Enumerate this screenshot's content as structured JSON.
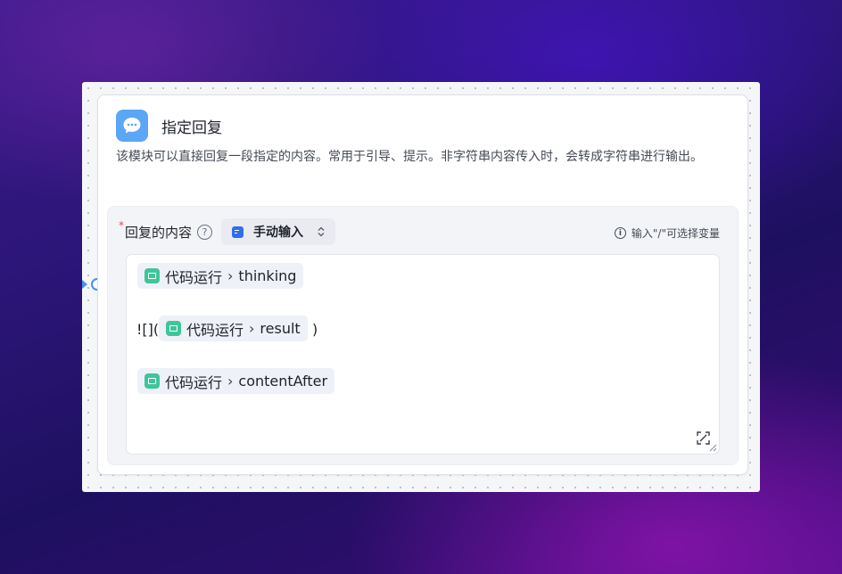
{
  "node": {
    "title": "指定回复",
    "description": "该模块可以直接回复一段指定的内容。常用于引导、提示。非字符串内容传入时，会转成字符串进行输出。",
    "icon": "chat-bubble-icon",
    "icon_color": "#5ba6f6"
  },
  "field": {
    "required_mark": "*",
    "label": "回复的内容",
    "help_icon": "?",
    "mode": {
      "selected": "手动输入",
      "icon": "text-input-icon"
    },
    "hint": "输入\"/\"可选择变量"
  },
  "editor": {
    "line1": {
      "source": "代码运行",
      "separator": "›",
      "variable": "thinking"
    },
    "line2": {
      "prefix": "![](",
      "source": "代码运行",
      "separator": "›",
      "variable": "result",
      "suffix": ")"
    },
    "line3": {
      "source": "代码运行",
      "separator": "›",
      "variable": "contentAfter"
    }
  },
  "colors": {
    "accent": "#4a8ff2",
    "variable_chip_icon": "#3fc59a",
    "required": "#e5484d"
  }
}
